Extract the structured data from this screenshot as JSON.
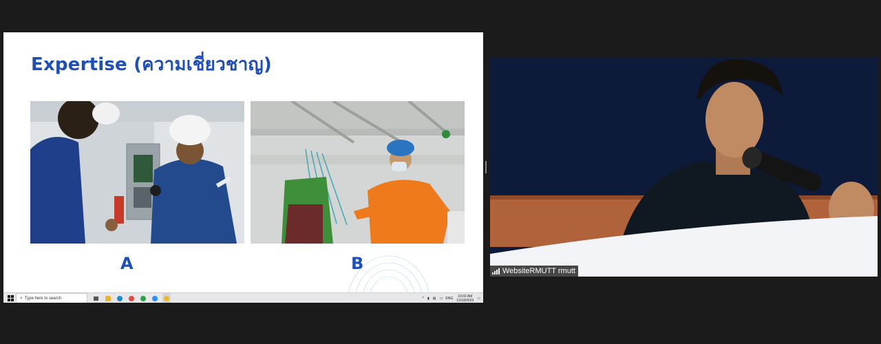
{
  "slide": {
    "title": "Expertise (ความเชี่ยวชาญ)",
    "caption_a": "A",
    "caption_b": "B"
  },
  "taskbar": {
    "search_placeholder": "Type here to search",
    "time": "10:02 AM",
    "date": "12/18/2023",
    "language": "ENG",
    "apps": [
      "task-view-icon",
      "file-explorer-icon",
      "edge-icon",
      "chrome-icon",
      "chrome-icon",
      "zoom-icon",
      "chrome-icon"
    ]
  },
  "video": {
    "participant_name": "WebsiteRMUTT rmutt"
  },
  "colors": {
    "slide_accent": "#1e4fb8",
    "background": "#1b1b1b"
  }
}
